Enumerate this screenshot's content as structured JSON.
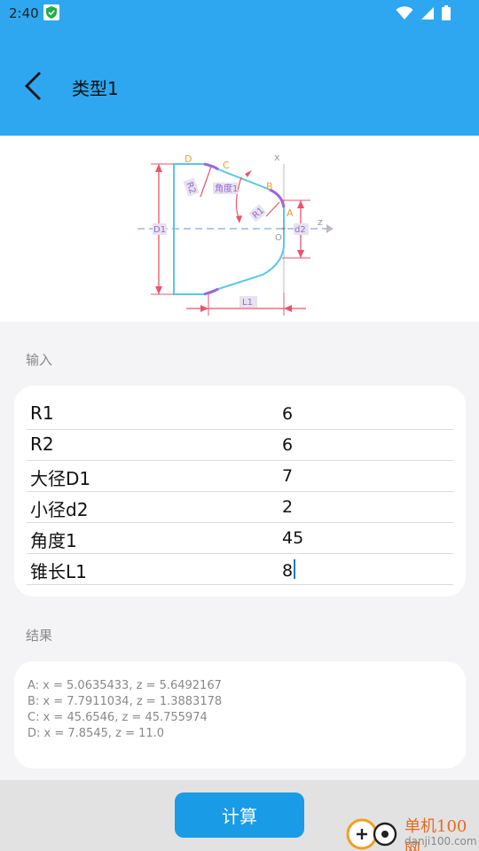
{
  "status": {
    "time": "2:40"
  },
  "header": {
    "title": "类型1"
  },
  "diagram": {
    "labels": {
      "D": "D",
      "C": "C",
      "B": "B",
      "A": "A",
      "O": "O",
      "x": "x",
      "z": "z",
      "R2": "R2",
      "R1": "R1",
      "angle": "角度1",
      "D1": "D1",
      "d2": "d2",
      "L1": "L1"
    }
  },
  "input": {
    "section_label": "输入",
    "rows": [
      {
        "label": "R1",
        "value": "6"
      },
      {
        "label": "R2",
        "value": "6"
      },
      {
        "label": "大径D1",
        "value": "7"
      },
      {
        "label": "小径d2",
        "value": "2"
      },
      {
        "label": "角度1",
        "value": "45"
      },
      {
        "label": "锥长L1",
        "value": "8"
      }
    ]
  },
  "result": {
    "section_label": "结果",
    "lines": [
      "A: x = 5.0635433, z = 5.6492167",
      "B: x = 7.7911034, z = 1.3883178",
      "C: x = 45.6546, z = 45.755974",
      "D: x = 7.8545, z = 11.0"
    ]
  },
  "actions": {
    "calculate_label": "计算"
  },
  "watermark": {
    "name": "单机100网",
    "url": "danji100.com"
  }
}
